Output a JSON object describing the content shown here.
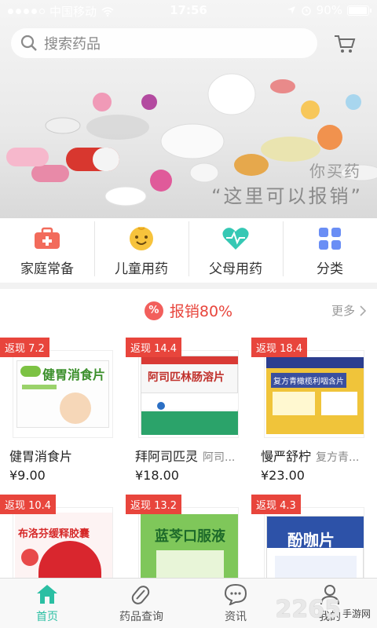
{
  "status_bar": {
    "carrier": "中国移动",
    "time": "17:56",
    "battery": "90%"
  },
  "search": {
    "placeholder": "搜索药品"
  },
  "banner": {
    "line1": "你买药",
    "line2": "“这里可以报销”"
  },
  "categories": [
    {
      "label": "家庭常备",
      "icon": "first-aid-kit-icon",
      "color": "#f26b5b"
    },
    {
      "label": "儿童用药",
      "icon": "child-face-icon",
      "color": "#f7c33c"
    },
    {
      "label": "父母用药",
      "icon": "heartbeat-icon",
      "color": "#35c8b4"
    },
    {
      "label": "分类",
      "icon": "grid-icon",
      "color": "#6a8ef5"
    }
  ],
  "section": {
    "badge": "%",
    "title": "报销80%",
    "more": "更多"
  },
  "products": [
    {
      "badge": "返现 7.2",
      "name": "健胃消食片",
      "sub": "",
      "price": "¥9.00",
      "box_text": "健胃消食片"
    },
    {
      "badge": "返现 14.4",
      "name": "拜阿司匹灵",
      "sub": "阿司...",
      "price": "¥18.00",
      "box_text": "阿司匹林肠溶片"
    },
    {
      "badge": "返现 18.4",
      "name": "慢严舒柠",
      "sub": "复方青...",
      "price": "¥23.00",
      "box_text": "复方青橄榄利咽含片"
    },
    {
      "badge": "返现 10.4",
      "name": "",
      "sub": "",
      "price": "",
      "box_text": "布洛芬缓释胶囊"
    },
    {
      "badge": "返现 13.2",
      "name": "",
      "sub": "",
      "price": "",
      "box_text": "蓝芩口服液"
    },
    {
      "badge": "返现 4.3",
      "name": "",
      "sub": "",
      "price": "",
      "box_text": "酚咖片"
    }
  ],
  "tabs": [
    {
      "label": "首页",
      "icon": "home-icon",
      "active": true
    },
    {
      "label": "药品查询",
      "icon": "pill-icon",
      "active": false
    },
    {
      "label": "资讯",
      "icon": "chat-bubble-icon",
      "active": false
    },
    {
      "label": "我的",
      "icon": "user-icon",
      "active": false
    }
  ],
  "watermark": {
    "number": "2265",
    "site": "手游网"
  },
  "colors": {
    "accent": "#2bbfa3",
    "red": "#e8453c"
  }
}
